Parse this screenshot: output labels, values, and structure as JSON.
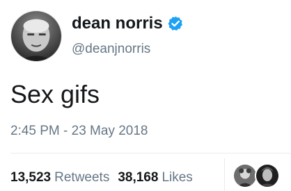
{
  "tweet": {
    "display_name": "dean norris",
    "handle": "@deanjnorris",
    "text": "Sex gifs",
    "timestamp": "2:45 PM - 23 May 2018",
    "verified": true,
    "stats": {
      "retweets_count": "13,523",
      "retweets_label": "Retweets",
      "likes_count": "38,168",
      "likes_label": "Likes"
    }
  },
  "colors": {
    "text_primary": "#14171a",
    "text_secondary": "#657786",
    "verified_blue": "#1da1f2",
    "divider": "#e6ecf0"
  },
  "icons": {
    "verified": "verified-badge-icon",
    "avatar": "profile-photo",
    "likers": [
      "liker-avatar",
      "liker-avatar"
    ]
  }
}
